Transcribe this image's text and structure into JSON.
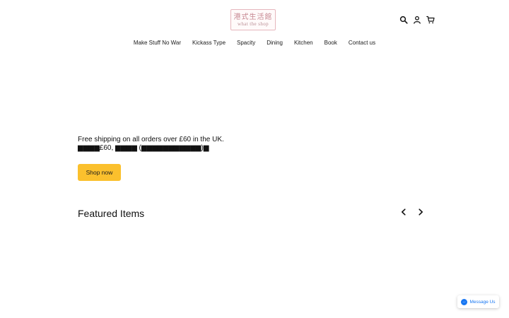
{
  "header": {
    "logo": {
      "chinese": "港式生活館",
      "english": "what the shop"
    },
    "icons": [
      "search-icon",
      "account-icon",
      "cart-icon"
    ]
  },
  "nav": {
    "items": [
      {
        "label": "Make Stuff No War"
      },
      {
        "label": "Kickass Type"
      },
      {
        "label": "Spacity"
      },
      {
        "label": "Dining"
      },
      {
        "label": "Kitchen"
      },
      {
        "label": "Book"
      },
      {
        "label": "Contact us"
      }
    ]
  },
  "hero": {
    "shipping_line": "Free shipping on all orders over £60 in the UK.",
    "shipping_line_cn": "▆▆▆▆£60, ▆▆▆▆ (▆▆▆▆▆▆▆▆▆▆▆)▆",
    "button_label": "Shop now",
    "accent_color": "#fbc02d"
  },
  "featured": {
    "title": "Featured Items",
    "prev_icon": "chevron-left-icon",
    "next_icon": "chevron-right-icon"
  },
  "messenger": {
    "label": "Message Us",
    "color": "#1877f2"
  }
}
